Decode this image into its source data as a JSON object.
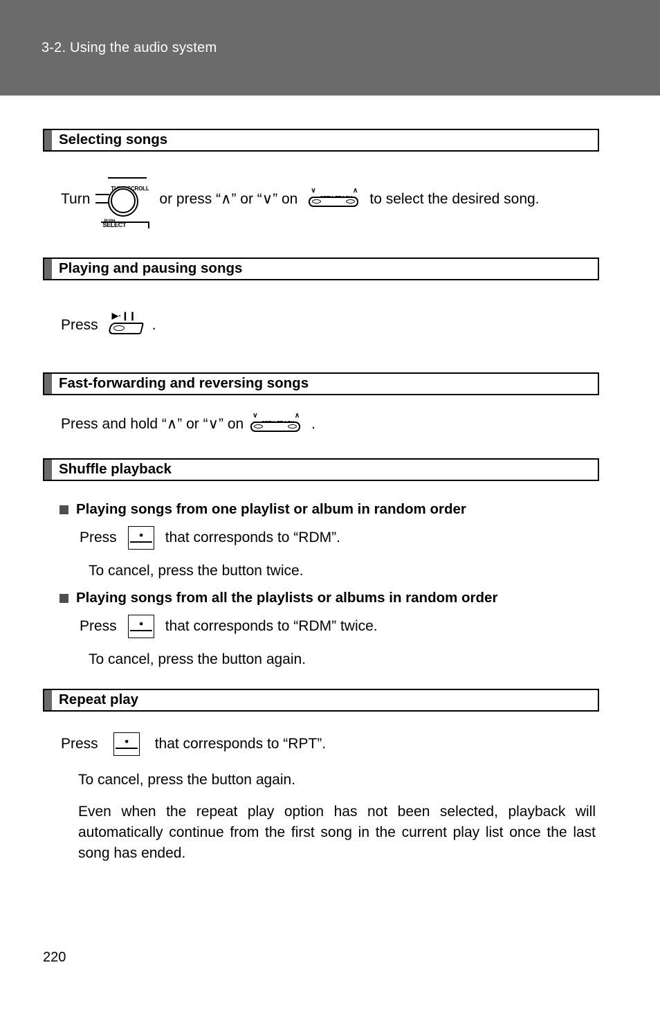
{
  "header": {
    "title": "3-2. Using the audio system"
  },
  "sections": [
    {
      "title": "Selecting songs",
      "instruction": {
        "lead": "Turn",
        "mid": "or press “∧” or “∨” on",
        "tail": "to select the desired song."
      }
    },
    {
      "title": "Playing and pausing songs",
      "instruction": {
        "lead": "Press",
        "tail": "."
      }
    },
    {
      "title": "Fast-forwarding and reversing songs",
      "instruction": {
        "lead": "Press and hold “∧” or “∨” on",
        "tail": "."
      }
    },
    {
      "title": "Shuffle playback",
      "bullets": [
        {
          "heading": "Playing songs from one playlist or album in random order",
          "lead": "Press",
          "tail": "that corresponds to “RDM”.",
          "note": "To cancel, press the button twice."
        },
        {
          "heading": "Playing songs from all the playlists or albums in random order",
          "lead": "Press",
          "tail": "that corresponds to “RDM” twice.",
          "note": "To cancel, press the button again."
        }
      ]
    },
    {
      "title": "Repeat play",
      "instruction": {
        "lead": "Press",
        "tail": "that corresponds to “RPT”."
      },
      "notes": [
        "To cancel, press the button again.",
        "Even when the repeat play option has not been selected, playback will automatically continue from the first song in the current play list once the last song has ended."
      ]
    }
  ],
  "icons": {
    "knob": {
      "label_top": "TUNE-SCROLL",
      "label_bottom_small": "PUSH",
      "label_bottom_big": "SELECT"
    },
    "seek_track": {
      "label": "SEEK·TRACK",
      "caret_down": "∨",
      "caret_up": "∧"
    },
    "play_pause": {
      "symbols": "▶·❙❙"
    },
    "preset_square": {
      "dot": "✸"
    }
  },
  "footer": {
    "page_number": "220"
  },
  "colors": {
    "header_band": "#6b6b6b",
    "section_tab": "#6b6b6b",
    "text": "#000000",
    "page_background": "#ffffff"
  }
}
